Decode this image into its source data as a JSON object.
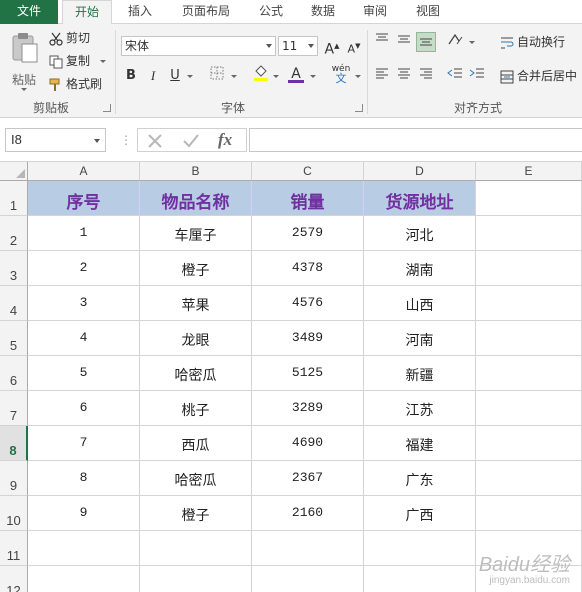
{
  "ribbon_tabs": [
    "文件",
    "开始",
    "插入",
    "页面布局",
    "公式",
    "数据",
    "审阅",
    "视图"
  ],
  "clipboard": {
    "paste_label": "粘贴",
    "cut_label": "剪切",
    "copy_label": "复制",
    "format_painter_label": "格式刷",
    "group_label": "剪贴板"
  },
  "font": {
    "name": "宋体",
    "size": "11",
    "bold": "B",
    "italic": "I",
    "underline": "U",
    "grow": "A",
    "shrink": "A",
    "font_color_glyph": "A",
    "phonetic_top": "wén",
    "phonetic_bottom": "文",
    "group_label": "字体"
  },
  "alignment": {
    "wrap_text_label": "自动换行",
    "merge_center_label": "合并后居中",
    "group_label": "对齐方式"
  },
  "formula_bar": {
    "name_box": "I8",
    "fx_label": "fx",
    "formula": ""
  },
  "colors": {
    "accent": "#217346",
    "header_fill": "#b8cce4",
    "header_text": "#7030a0",
    "font_color_bar": "#7030a0",
    "fill_color_bar": "#ffff00"
  },
  "sheet": {
    "columns": [
      "A",
      "B",
      "C",
      "D",
      "E"
    ],
    "rows": [
      "1",
      "2",
      "3",
      "4",
      "5",
      "6",
      "7",
      "8",
      "9",
      "10",
      "11",
      "12"
    ],
    "selected_row": "8",
    "header": [
      "序号",
      "物品名称",
      "销量",
      "货源地址"
    ],
    "data": [
      [
        "1",
        "车厘子",
        "2579",
        "河北"
      ],
      [
        "2",
        "橙子",
        "4378",
        "湖南"
      ],
      [
        "3",
        "苹果",
        "4576",
        "山西"
      ],
      [
        "4",
        "龙眼",
        "3489",
        "河南"
      ],
      [
        "5",
        "哈密瓜",
        "5125",
        "新疆"
      ],
      [
        "6",
        "桃子",
        "3289",
        "江苏"
      ],
      [
        "7",
        "西瓜",
        "4690",
        "福建"
      ],
      [
        "8",
        "哈密瓜",
        "2367",
        "广东"
      ],
      [
        "9",
        "橙子",
        "2160",
        "广西"
      ]
    ]
  },
  "watermark": {
    "brand": "Baidu经验",
    "url": "jingyan.baidu.com"
  }
}
